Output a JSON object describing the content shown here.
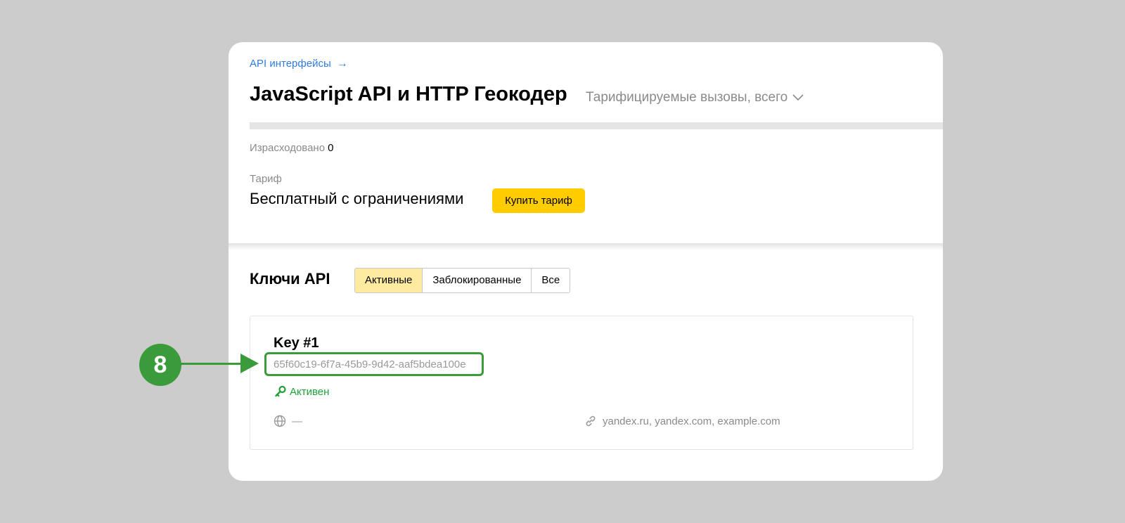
{
  "header": {
    "breadcrumb": "API интерфейсы",
    "breadcrumb_arrow": "→",
    "title": "JavaScript API и HTTP Геокодер",
    "calls_dropdown": "Тарифицируемые вызовы, всего"
  },
  "usage": {
    "label": "Израсходовано",
    "value": "0",
    "fraction_used": 0
  },
  "tariff": {
    "label": "Тариф",
    "name": "Бесплатный с ограничениями",
    "buy_label": "Купить тариф"
  },
  "keys": {
    "title": "Ключи API",
    "tabs": [
      {
        "label": "Активные",
        "active": true
      },
      {
        "label": "Заблокированные",
        "active": false
      },
      {
        "label": "Все",
        "active": false
      }
    ],
    "items": [
      {
        "name": "Key #1",
        "value": "65f60c19-6f7a-45b9-9d42-aaf5bdea100e",
        "status": "Активен",
        "geo": "—",
        "domains": "yandex.ru, yandex.com, example.com"
      }
    ]
  },
  "annotation": {
    "step": "8",
    "color": "#3a9b3a"
  },
  "colors": {
    "accent_link": "#2f7ce0",
    "button_yellow": "#ffcc00",
    "active_tab": "#ffeba0",
    "status_green": "#21a038",
    "background": "#cccccc"
  },
  "icons": [
    "arrow-right-icon",
    "chevron-down-icon",
    "key-icon",
    "globe-icon",
    "link-icon"
  ]
}
